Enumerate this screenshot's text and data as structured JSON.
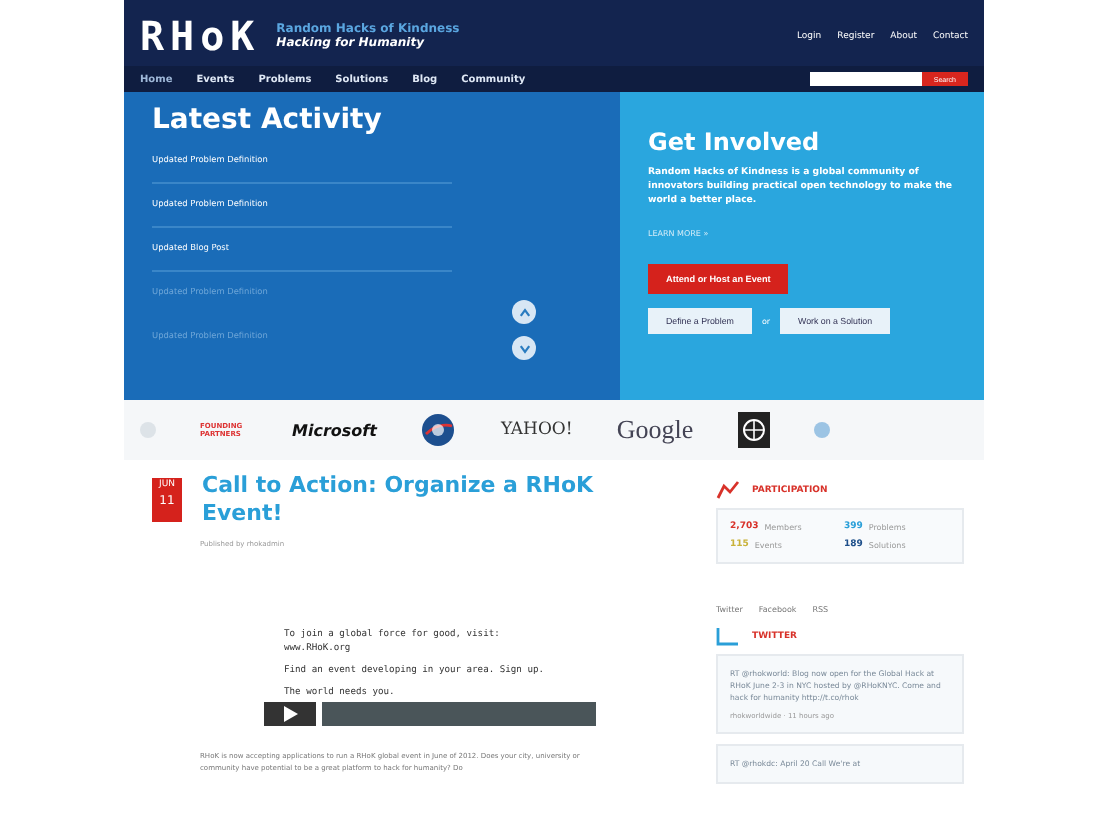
{
  "header": {
    "logo": "RHoK",
    "site_name": "Random Hacks of Kindness",
    "tagline": "Hacking for Humanity",
    "top_links": [
      "Login",
      "Register",
      "About",
      "Contact"
    ]
  },
  "nav": {
    "items": [
      {
        "label": "Home",
        "selected": true
      },
      {
        "label": "Events",
        "selected": false
      },
      {
        "label": "Problems",
        "selected": false
      },
      {
        "label": "Solutions",
        "selected": false
      },
      {
        "label": "Blog",
        "selected": false
      },
      {
        "label": "Community",
        "selected": false
      }
    ],
    "search_button": "Search"
  },
  "latest_activity": {
    "title": "Latest Activity",
    "items": [
      {
        "label": "Updated Problem Definition",
        "faded": false
      },
      {
        "label": "Updated Problem Definition",
        "faded": false
      },
      {
        "label": "Updated Blog Post",
        "faded": false
      },
      {
        "label": "Updated Problem Definition",
        "faded": true
      },
      {
        "label": "Updated Problem Definition",
        "faded": true
      }
    ]
  },
  "get_involved": {
    "title": "Get Involved",
    "text": "Random Hacks of Kindness is a global community of innovators building practical open technology to make the world a better place.",
    "learn_more": "LEARN MORE »",
    "primary_button": "Attend or Host an Event",
    "secondary_buttons": [
      "Define a Problem",
      "Work on a Solution"
    ],
    "separator": "or"
  },
  "partners": {
    "label": "FOUNDING PARTNERS",
    "logos": [
      {
        "kind": "text",
        "name": "Microsoft"
      },
      {
        "kind": "globe"
      },
      {
        "kind": "serif",
        "name": "YAHOO!"
      },
      {
        "kind": "google",
        "name": "Google"
      },
      {
        "kind": "square"
      }
    ]
  },
  "article": {
    "date_month": "JUN",
    "date_day": "11",
    "title": "Call to Action: Organize a RHoK Event!",
    "byline": "Published by rhokadmin",
    "video_lines": [
      "To join a global force for good, visit: www.RHoK.org",
      "Find an event developing in your area. Sign up.",
      "The world needs you."
    ],
    "body": "RHoK is now accepting applications to run a RHoK global event in June of 2012. Does your city, university or community have potential to be a great platform to hack for humanity? Do"
  },
  "sidebar": {
    "participation_title": "PARTICIPATION",
    "stats": [
      {
        "value": "2,703",
        "label": "Members",
        "color": "#d8322a"
      },
      {
        "value": "399",
        "label": "Problems",
        "color": "#2a9fd8"
      },
      {
        "value": "115",
        "label": "Events",
        "color": "#c9b23a"
      },
      {
        "value": "189",
        "label": "Solutions",
        "color": "#1e4f8a"
      }
    ],
    "social_links": [
      "Twitter",
      "Facebook",
      "RSS"
    ],
    "twitter_title": "TWITTER",
    "tweets": [
      {
        "text": "RT @rhokworld: Blog now open for the Global Hack at RHoK June 2-3 in NYC hosted by @RHoKNYC. Come and hack for humanity http://t.co/rhok",
        "meta": "rhokworldwide · 11 hours ago"
      },
      {
        "text": "RT @rhokdc: April 20 Call We're at"
      }
    ]
  }
}
